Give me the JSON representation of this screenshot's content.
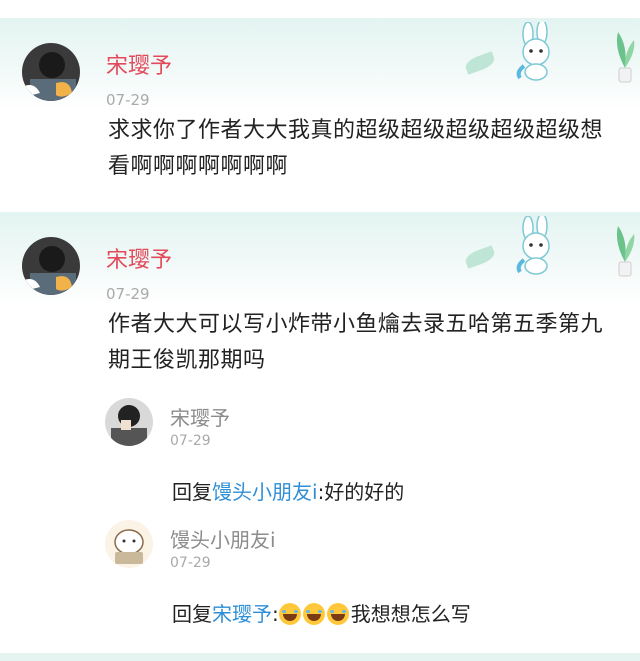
{
  "comments": [
    {
      "author": "宋璎予",
      "date": "07-29",
      "text": "求求你了作者大大我真的超级超级超级超级超级想看啊啊啊啊啊啊啊"
    },
    {
      "author": "宋璎予",
      "date": "07-29",
      "text": "作者大大可以写小炸带小鱼爚去录五哈第五季第九期王俊凯那期吗",
      "replies": [
        {
          "author": "宋璎予",
          "date": "07-29",
          "prefix": "回复",
          "mention": "馒头小朋友i",
          "colon": ":",
          "text": "好的好的"
        },
        {
          "author": "馒头小朋友i",
          "date": "07-29",
          "prefix": "回复",
          "mention": "宋璎予",
          "colon": ":",
          "emoji": "laughing-tears-emoji",
          "text": "我想想怎么写"
        }
      ]
    }
  ],
  "colors": {
    "author": "#e24a5a",
    "mention": "#2f8fd6",
    "date": "#a9a9a9",
    "header_bg": "#e3f4f1"
  }
}
